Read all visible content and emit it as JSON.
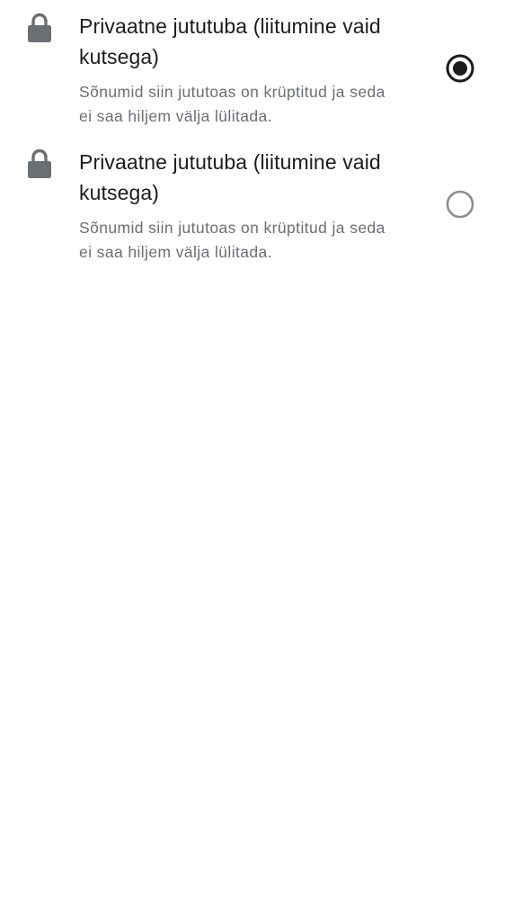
{
  "options": [
    {
      "icon": "lock-icon",
      "title": "Privaatne jututuba (liitumine vaid kutsega)",
      "description": "Sõnumid siin jututoas on krüptitud ja seda ei saa hiljem välja lülitada.",
      "selected": true
    },
    {
      "icon": "lock-icon",
      "title": "Privaatne jututuba (liitumine vaid kutsega)",
      "description": "Sõnumid siin jututoas on krüptitud ja seda ei saa hiljem välja lülitada.",
      "selected": false
    }
  ],
  "colors": {
    "icon": "#6b6e73",
    "title": "#1c1b1f",
    "description": "#6b6e73",
    "radio_selected": "#1c1b1f",
    "radio_unselected": "#8a8d91"
  }
}
